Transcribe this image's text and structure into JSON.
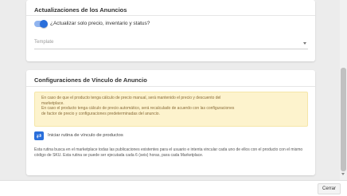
{
  "ads_updates": {
    "title": "Actualizaciones de los Anuncios",
    "toggle_label": "¿Actualizar solo precio, inventario y status?",
    "toggle_on": true,
    "template_placeholder": "Template"
  },
  "link_config": {
    "title": "Configuraciones de Vínculo de Anuncio",
    "warning_lines": [
      "En caso de que el producto tenga cálculo de precio manual, será mantenido el precio y descuento del",
      "marketplace.",
      "En caso el producto tenga cálculo de precio automático, será recalculado de acuerdo con las configuraciones",
      "de factor de precio y configuraciones predeterminadas del anuncio."
    ],
    "link_button_label": "Iniciar rutina de vínculo de productos",
    "description": "Esta rutina busca en el marketplace todas las publicaciones existentes para el usuario e intenta vincular cada uno de ellos con el producto con el mismo código de SKU. Esta rutina se puede ser ejecutada cada 6 (seis) horas, para cada Marketplace."
  },
  "footer": {
    "close_label": "Cerrar"
  },
  "colors": {
    "accent": "#2a6fdb",
    "warning_bg": "#fdf3cd",
    "warning_text": "#8a6d3b"
  },
  "icons": {
    "toggle": "toggle-switch",
    "link_button": "swap-arrows-icon",
    "template_caret": "chevron-down-icon"
  }
}
